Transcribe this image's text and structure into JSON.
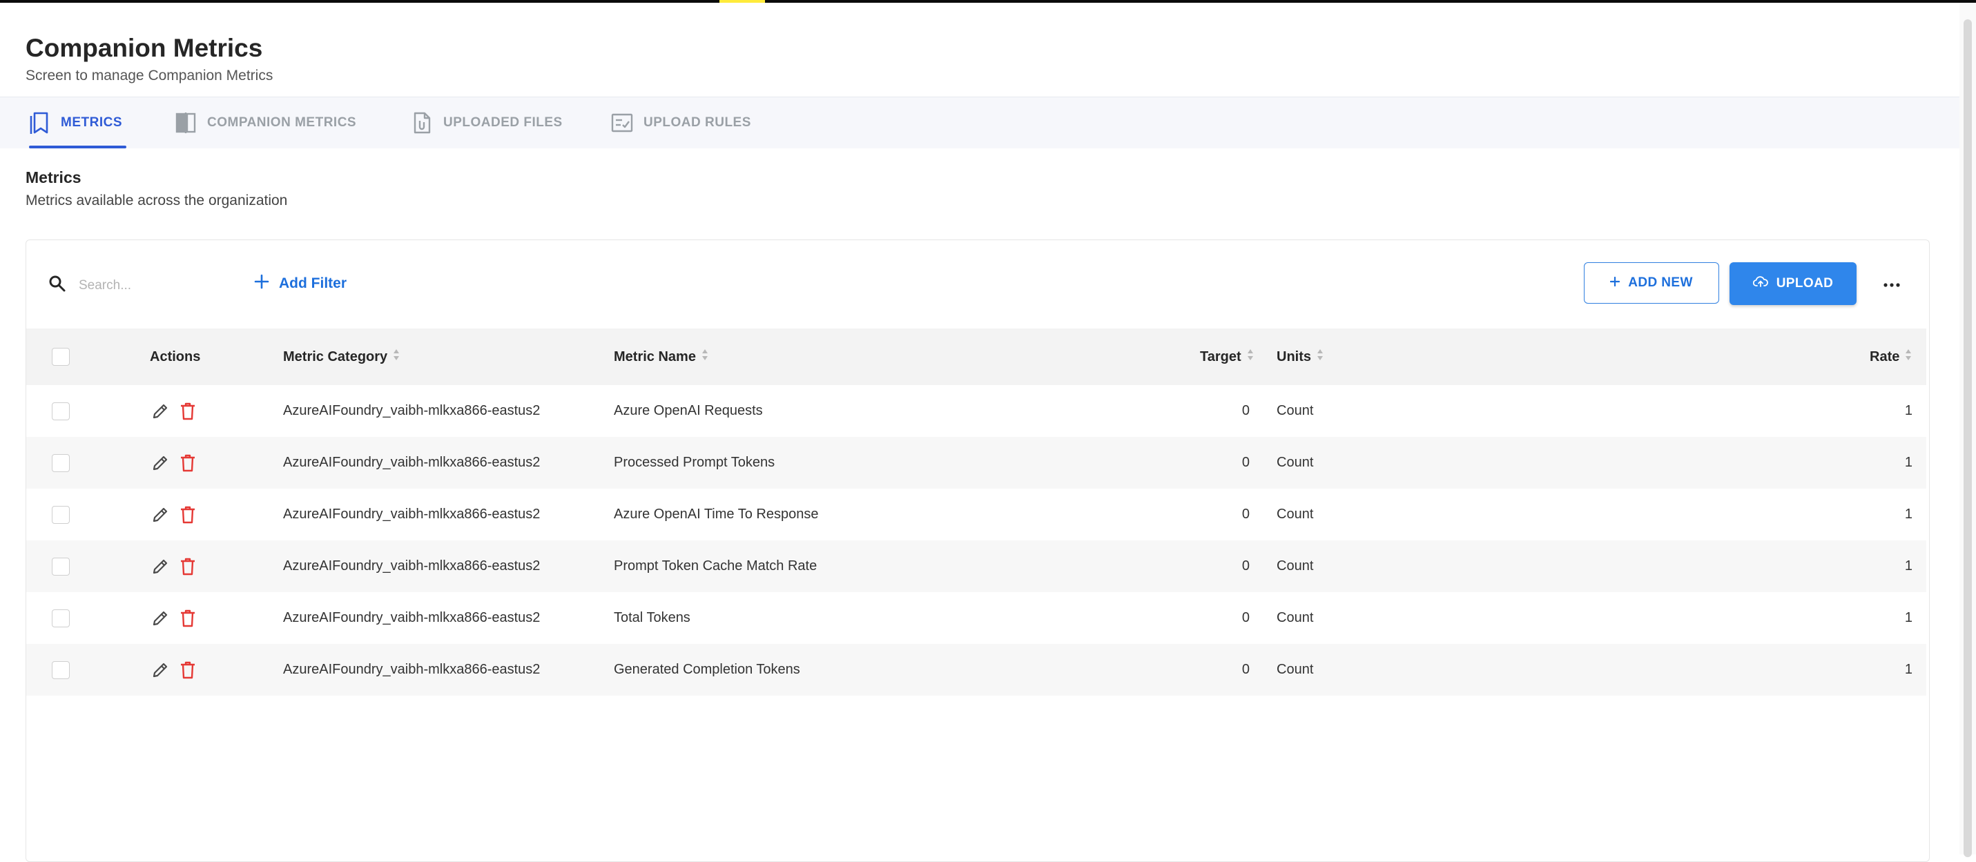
{
  "header": {
    "title": "Companion Metrics",
    "subtitle": "Screen to manage Companion Metrics"
  },
  "tabs": [
    {
      "label": "METRICS",
      "icon": "bookmarks-icon",
      "active": true
    },
    {
      "label": "COMPANION METRICS",
      "icon": "compare-icon",
      "active": false
    },
    {
      "label": "UPLOADED FILES",
      "icon": "file-attachment-icon",
      "active": false
    },
    {
      "label": "UPLOAD RULES",
      "icon": "checklist-icon",
      "active": false
    }
  ],
  "section": {
    "title": "Metrics",
    "subtitle": "Metrics available across the organization"
  },
  "toolbar": {
    "search_placeholder": "Search...",
    "add_filter_label": "Add Filter",
    "add_new_label": "ADD NEW",
    "upload_label": "UPLOAD"
  },
  "table": {
    "columns": {
      "actions": "Actions",
      "category": "Metric Category",
      "name": "Metric Name",
      "target": "Target",
      "units": "Units",
      "rate": "Rate"
    },
    "rows": [
      {
        "category": "AzureAIFoundry_vaibh-mlkxa866-eastus2",
        "name": "Azure OpenAI Requests",
        "target": "0",
        "units": "Count",
        "rate": "1"
      },
      {
        "category": "AzureAIFoundry_vaibh-mlkxa866-eastus2",
        "name": "Processed Prompt Tokens",
        "target": "0",
        "units": "Count",
        "rate": "1"
      },
      {
        "category": "AzureAIFoundry_vaibh-mlkxa866-eastus2",
        "name": "Azure OpenAI Time To Response",
        "target": "0",
        "units": "Count",
        "rate": "1"
      },
      {
        "category": "AzureAIFoundry_vaibh-mlkxa866-eastus2",
        "name": "Prompt Token Cache Match Rate",
        "target": "0",
        "units": "Count",
        "rate": "1"
      },
      {
        "category": "AzureAIFoundry_vaibh-mlkxa866-eastus2",
        "name": "Total Tokens",
        "target": "0",
        "units": "Count",
        "rate": "1"
      },
      {
        "category": "AzureAIFoundry_vaibh-mlkxa866-eastus2",
        "name": "Generated Completion Tokens",
        "target": "0",
        "units": "Count",
        "rate": "1"
      }
    ]
  },
  "colors": {
    "primary": "#2f5bd6",
    "button_blue": "#2f86eb",
    "delete_red": "#e53935"
  }
}
